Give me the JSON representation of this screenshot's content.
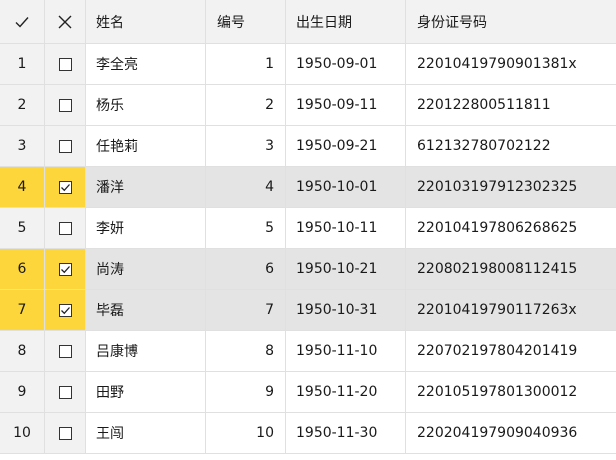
{
  "header": {
    "check_all": "check-icon",
    "clear_all": "close-icon",
    "columns": [
      "姓名",
      "编号",
      "出生日期",
      "身份证号码"
    ]
  },
  "rows": [
    {
      "index": "1",
      "checked": false,
      "name": "李全亮",
      "number": "1",
      "birth_date": "1950-09-01",
      "id_number": "22010419790901381x"
    },
    {
      "index": "2",
      "checked": false,
      "name": "杨乐",
      "number": "2",
      "birth_date": "1950-09-11",
      "id_number": "220122800511811"
    },
    {
      "index": "3",
      "checked": false,
      "name": "任艳莉",
      "number": "3",
      "birth_date": "1950-09-21",
      "id_number": "612132780702122"
    },
    {
      "index": "4",
      "checked": true,
      "name": "潘洋",
      "number": "4",
      "birth_date": "1950-10-01",
      "id_number": "220103197912302325"
    },
    {
      "index": "5",
      "checked": false,
      "name": "李妍",
      "number": "5",
      "birth_date": "1950-10-11",
      "id_number": "220104197806268625"
    },
    {
      "index": "6",
      "checked": true,
      "name": "尚涛",
      "number": "6",
      "birth_date": "1950-10-21",
      "id_number": "220802198008112415"
    },
    {
      "index": "7",
      "checked": true,
      "name": "毕磊",
      "number": "7",
      "birth_date": "1950-10-31",
      "id_number": "22010419790117263x"
    },
    {
      "index": "8",
      "checked": false,
      "name": "吕康博",
      "number": "8",
      "birth_date": "1950-11-10",
      "id_number": "220702197804201419"
    },
    {
      "index": "9",
      "checked": false,
      "name": "田野",
      "number": "9",
      "birth_date": "1950-11-20",
      "id_number": "220105197801300012"
    },
    {
      "index": "10",
      "checked": false,
      "name": "王闯",
      "number": "10",
      "birth_date": "1950-11-30",
      "id_number": "220204197909040936"
    }
  ]
}
